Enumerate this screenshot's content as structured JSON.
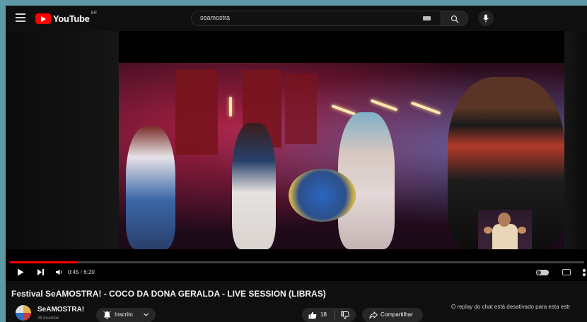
{
  "header": {
    "logo_text": "YouTube",
    "logo_country": "BR",
    "search_value": "seamostra"
  },
  "player": {
    "current_time": "0:45",
    "separator": "/",
    "duration": "6:20",
    "progress_fraction": 0.118
  },
  "video": {
    "title": "Festival SeAMOSTRA! - COCO DA DONA GERALDA - LIVE SESSION (LIBRAS)"
  },
  "channel": {
    "name": "SeAMOSTRA!",
    "subscribers": "29 inscritos",
    "subscribe_label": "Inscrito"
  },
  "actions": {
    "like_count": "18",
    "share_label": "Compartilhar"
  },
  "chat": {
    "notice": "O replay do chat está desativado para esta estr"
  },
  "colors": {
    "accent": "#ff0000",
    "background": "#0f0f0f",
    "frame": "#5c9aa6"
  },
  "icons": [
    "menu-icon",
    "youtube-logo-icon",
    "keyboard-icon",
    "search-icon",
    "mic-icon",
    "play-icon",
    "next-icon",
    "volume-icon",
    "autoplay-toggle-icon",
    "captions-icon",
    "settings-icon",
    "bell-icon",
    "chevron-down-icon",
    "thumbs-up-icon",
    "thumbs-down-icon",
    "share-icon"
  ]
}
